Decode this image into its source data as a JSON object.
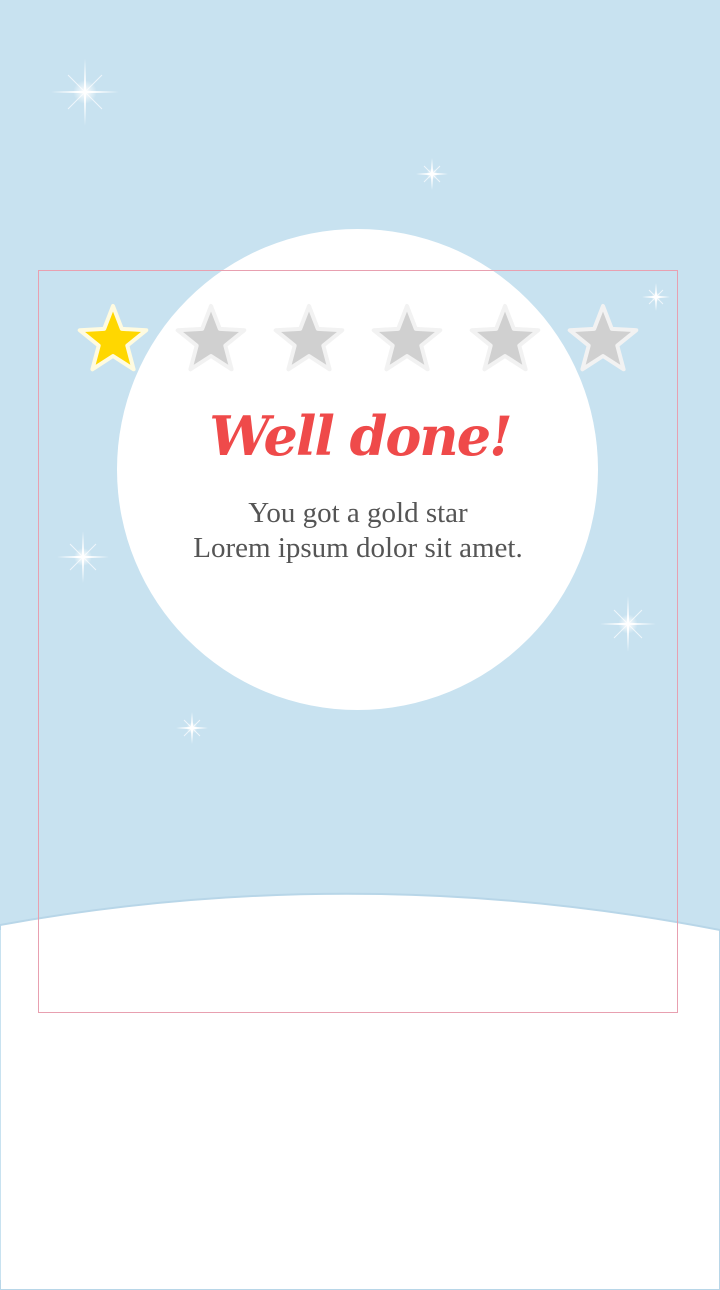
{
  "rating": {
    "value": 1,
    "max": 5,
    "stars_shown": 6,
    "filled_color": "#ffd700",
    "empty_color": "#d0d0d0"
  },
  "message": {
    "title": "Well done!",
    "line1": "You got a gold star",
    "line2": "Lorem ipsum dolor sit amet."
  },
  "colors": {
    "sky": "#c8e2f0",
    "title": "#ef4a4a",
    "text": "#555555"
  }
}
